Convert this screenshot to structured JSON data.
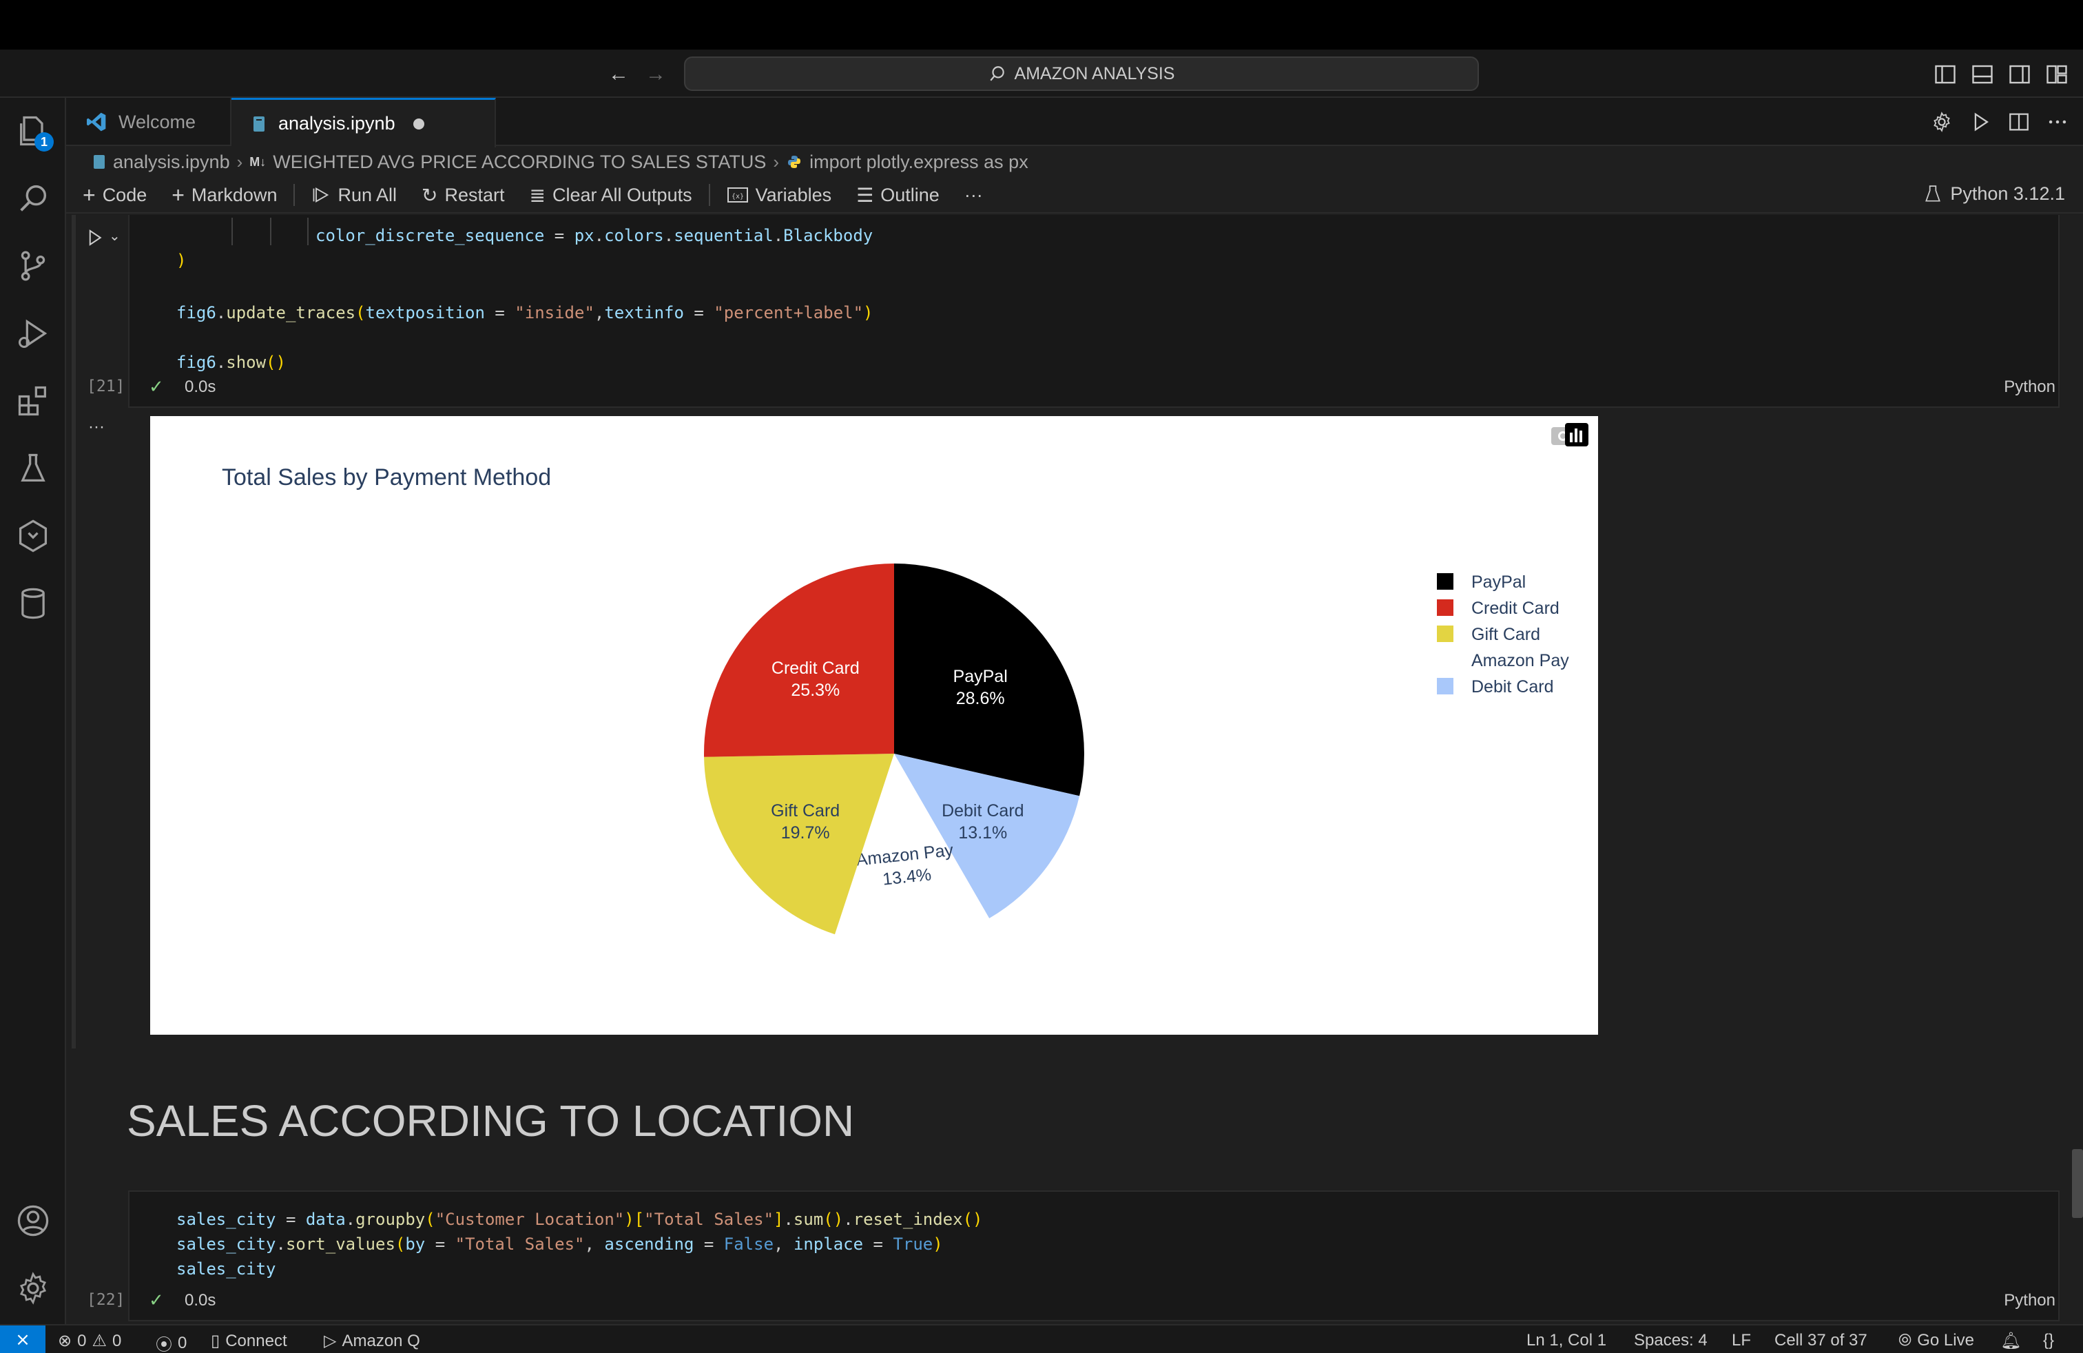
{
  "command_center": {
    "label": "AMAZON ANALYSIS"
  },
  "activity_bar": {
    "explorer_badge": "1"
  },
  "tabs": [
    {
      "label": "Welcome"
    },
    {
      "label": "analysis.ipynb"
    }
  ],
  "breadcrumb": {
    "file": "analysis.ipynb",
    "section": "WEIGHTED AVG PRICE ACCORDING TO SALES STATUS",
    "cell": "import plotly.express as px"
  },
  "toolbar": {
    "code": "Code",
    "markdown": "Markdown",
    "run_all": "Run All",
    "restart": "Restart",
    "clear_outputs": "Clear All Outputs",
    "variables": "Variables",
    "outline": "Outline",
    "more": "···",
    "kernel": "Python 3.12.1"
  },
  "cell21": {
    "lines": [
      {
        "a": "color_discrete_sequence",
        "b": " = ",
        "c": "px",
        "d": ".",
        "e": "colors",
        "f": ".",
        "g": "sequential",
        "h": ".",
        "i": "Blackbody"
      },
      ")",
      "fig6.update_traces(textposition = \"inside\",textinfo = \"percent+label\")",
      "fig6.show()"
    ],
    "line1_var": "color_discrete_sequence",
    "line1_px": "px",
    "line1_colors": "colors",
    "line1_seq": "sequential",
    "line1_bb": "Blackbody",
    "line2": ")",
    "line3_obj": "fig6",
    "line3_fn": "update_traces",
    "line3_a1": "textposition",
    "line3_v1": "\"inside\"",
    "line3_a2": "textinfo",
    "line3_v2": "\"percent+label\"",
    "line4_obj": "fig6",
    "line4_fn": "show",
    "exec_count": "[21]",
    "check": "✓",
    "time": "0.0s",
    "lang": "Python",
    "output_more": "···"
  },
  "chart_data": {
    "type": "pie",
    "title": "Total Sales by Payment Method",
    "legend_position": "right",
    "slices": [
      {
        "label": "PayPal",
        "percent": 28.6,
        "percent_text": "28.6%",
        "color": "#000000",
        "text_color": "#ffffff"
      },
      {
        "label": "Debit Card",
        "percent": 13.1,
        "percent_text": "13.1%",
        "color": "#a9c8fa",
        "text_color": "#2a3f5f"
      },
      {
        "label": "Amazon Pay",
        "percent": 13.4,
        "percent_text": "13.4%",
        "color": "#ffffff",
        "text_color": "#2a3f5f"
      },
      {
        "label": "Gift Card",
        "percent": 19.7,
        "percent_text": "19.7%",
        "color": "#e3d442",
        "text_color": "#2a3f5f"
      },
      {
        "label": "Credit Card",
        "percent": 25.3,
        "percent_text": "25.3%",
        "color": "#d42a1e",
        "text_color": "#ffffff"
      }
    ],
    "legend_order": [
      "PayPal",
      "Credit Card",
      "Gift Card",
      "Amazon Pay",
      "Debit Card"
    ]
  },
  "markdown": {
    "heading": "SALES ACCORDING TO LOCATION"
  },
  "cell22": {
    "line1_a": "sales_city",
    "line1_b": "data",
    "line1_fn": "groupby",
    "line1_s1": "\"Customer Location\"",
    "line1_s2": "\"Total Sales\"",
    "line1_fn2": "sum",
    "line1_fn3": "reset_index",
    "line2_a": "sales_city",
    "line2_fn": "sort_values",
    "line2_by": "by",
    "line2_s": "\"Total Sales\"",
    "line2_asc": "ascending",
    "line2_false": "False",
    "line2_inplace": "inplace",
    "line2_true": "True",
    "line3": "sales_city",
    "exec_count": "[22]",
    "check": "✓",
    "time": "0.0s",
    "lang": "Python"
  },
  "status_bar": {
    "errors": "0",
    "warnings": "0",
    "ports": "0",
    "connect": "Connect",
    "amazon_q": "Amazon Q",
    "position": "Ln 1, Col 1",
    "spaces": "Spaces: 4",
    "eol": "LF",
    "cell": "Cell 37 of 37",
    "go_live": "Go Live"
  }
}
